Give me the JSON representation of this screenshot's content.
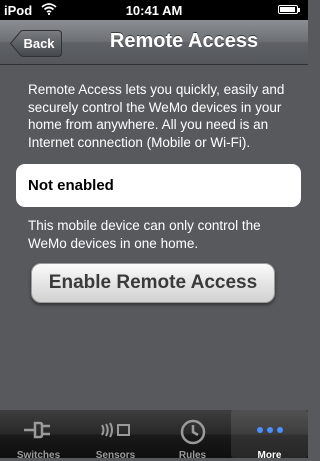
{
  "status_bar": {
    "carrier": "iPod",
    "time": "10:41 AM"
  },
  "nav": {
    "back_label": "Back",
    "title": "Remote Access"
  },
  "main": {
    "description": "Remote Access lets you quickly, easily and securely control the WeMo devices in your home from anywhere. All you need is an Internet connection (Mobile or Wi-Fi).",
    "status_text": "Not enabled",
    "note": "This mobile device can only control the WeMo devices in one home.",
    "enable_button_label": "Enable Remote Access"
  },
  "tabs": [
    {
      "label": "Switches",
      "icon": "plug-icon"
    },
    {
      "label": "Sensors",
      "icon": "sensor-icon"
    },
    {
      "label": "Rules",
      "icon": "clock-icon"
    },
    {
      "label": "More",
      "icon": "more-dots-icon",
      "active": true
    }
  ],
  "colors": {
    "active_tab_dots": "#4a90ff",
    "background": "#58595d"
  }
}
